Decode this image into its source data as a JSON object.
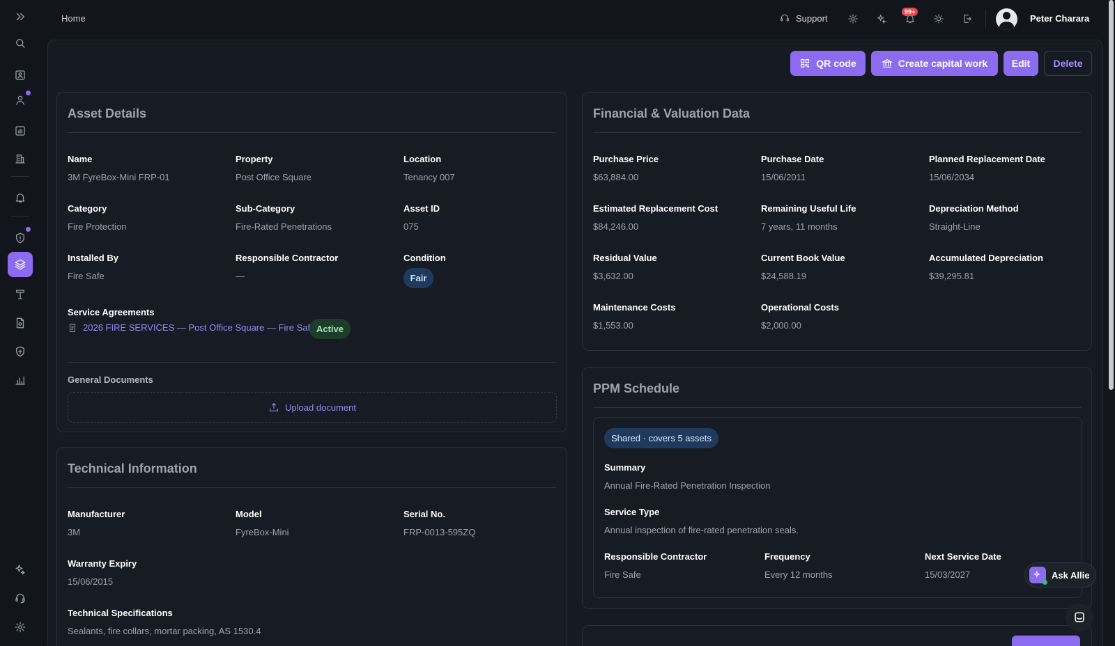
{
  "topbar": {
    "breadcrumb": "Home",
    "support_label": "Support",
    "notification_badge": "99+",
    "user_name": "Peter Charara"
  },
  "actions": {
    "qr_code": "QR code",
    "create_capital_work": "Create capital work",
    "edit": "Edit",
    "delete": "Delete"
  },
  "asset_details": {
    "title": "Asset Details",
    "fields": [
      {
        "label": "Name",
        "value": "3M FyreBox-Mini FRP-01"
      },
      {
        "label": "Property",
        "value": "Post Office Square"
      },
      {
        "label": "Location",
        "value": "Tenancy 007"
      },
      {
        "label": "Category",
        "value": "Fire Protection"
      },
      {
        "label": "Sub-Category",
        "value": "Fire-Rated Penetrations"
      },
      {
        "label": "Asset ID",
        "value": "075"
      },
      {
        "label": "Installed By",
        "value": "Fire Safe"
      },
      {
        "label": "Responsible Contractor",
        "value": "—"
      },
      {
        "label": "Condition",
        "value": "Fair"
      }
    ],
    "service_agreements_label": "Service Agreements",
    "service_agreement_link": "2026 FIRE SERVICES — Post Office Square — Fire Safe",
    "service_agreement_status": "Active",
    "general_documents_label": "General Documents",
    "upload_label": "Upload document"
  },
  "technical": {
    "title": "Technical Information",
    "fields": [
      {
        "label": "Manufacturer",
        "value": "3M"
      },
      {
        "label": "Model",
        "value": "FyreBox-Mini"
      },
      {
        "label": "Serial No.",
        "value": "FRP-0013-595ZQ"
      },
      {
        "label": "Warranty Expiry",
        "value": "15/06/2015"
      },
      {
        "label": "Technical Specifications",
        "value": "Sealants, fire collars, mortar packing, AS 1530.4"
      }
    ]
  },
  "financial": {
    "title": "Financial & Valuation Data",
    "fields": [
      {
        "label": "Purchase Price",
        "value": "$63,884.00"
      },
      {
        "label": "Purchase Date",
        "value": "15/06/2011"
      },
      {
        "label": "Planned Replacement Date",
        "value": "15/06/2034"
      },
      {
        "label": "Estimated Replacement Cost",
        "value": "$84,246.00"
      },
      {
        "label": "Remaining Useful Life",
        "value": "7 years, 11 months"
      },
      {
        "label": "Depreciation Method",
        "value": "Straight-Line"
      },
      {
        "label": "Residual Value",
        "value": "$3,632.00"
      },
      {
        "label": "Current Book Value",
        "value": "$24,588.19"
      },
      {
        "label": "Accumulated Depreciation",
        "value": "$39,295.81"
      },
      {
        "label": "Maintenance Costs",
        "value": "$1,553.00"
      },
      {
        "label": "Operational Costs",
        "value": "$2,000.00"
      }
    ]
  },
  "ppm": {
    "title": "PPM Schedule",
    "shared_badge": "Shared · covers 5 assets",
    "summary_label": "Summary",
    "summary_value": "Annual Fire-Rated Penetration Inspection",
    "service_type_label": "Service Type",
    "service_type_value": "Annual inspection of fire-rated penetration seals.",
    "contractor_label": "Responsible Contractor",
    "contractor_value": "Fire Safe",
    "frequency_label": "Frequency",
    "frequency_value": "Every 12 months",
    "next_service_label": "Next Service Date",
    "next_service_value": "15/03/2027"
  },
  "assistant": {
    "ask_label": "Ask Allie"
  },
  "colors": {
    "accent": "#8b6cf0",
    "background": "#12151c",
    "card": "#171b23",
    "link": "#9b86f5",
    "active_badge": "#1d3d2b",
    "fair_badge": "#1f3a5c"
  }
}
